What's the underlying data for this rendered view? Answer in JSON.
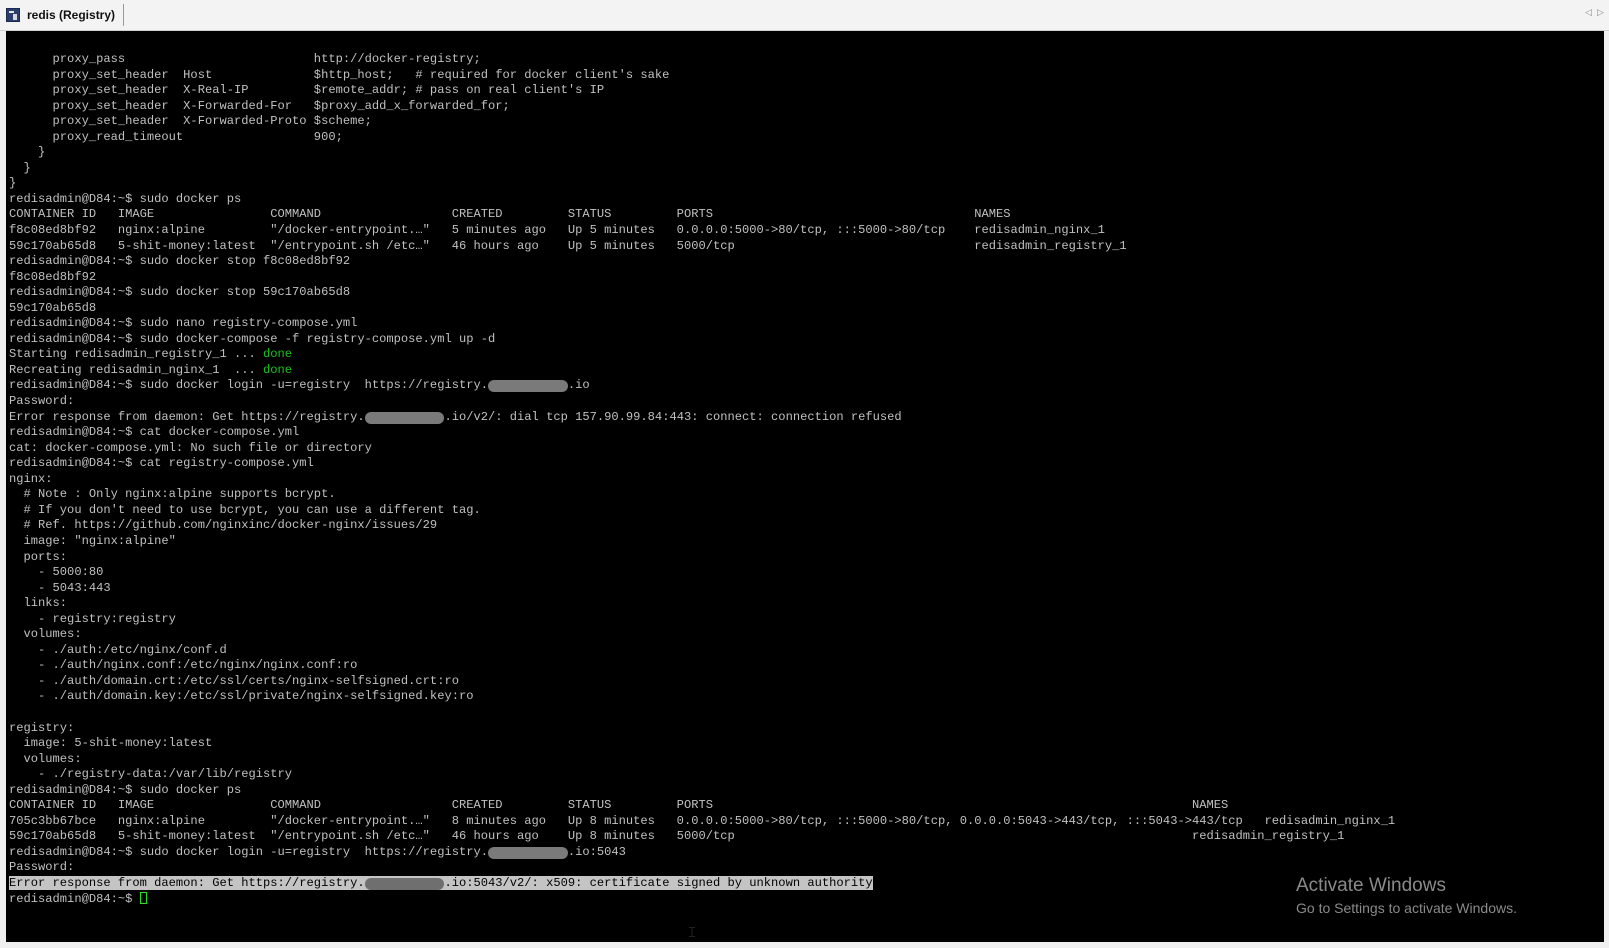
{
  "window": {
    "tab_title": "redis (Registry)",
    "scroll_left": "◁",
    "scroll_right": "▷"
  },
  "terminal": {
    "lines": [
      {
        "text": "      proxy_pass                          http://docker-registry;"
      },
      {
        "text": "      proxy_set_header  Host              $http_host;   # required for docker client's sake"
      },
      {
        "text": "      proxy_set_header  X-Real-IP         $remote_addr; # pass on real client's IP"
      },
      {
        "text": "      proxy_set_header  X-Forwarded-For   $proxy_add_x_forwarded_for;"
      },
      {
        "text": "      proxy_set_header  X-Forwarded-Proto $scheme;"
      },
      {
        "text": "      proxy_read_timeout                  900;"
      },
      {
        "text": "    }"
      },
      {
        "text": "  }"
      },
      {
        "text": "}"
      },
      {
        "text": "redisadmin@D84:~$ sudo docker ps"
      },
      {
        "text": "CONTAINER ID   IMAGE                COMMAND                  CREATED         STATUS         PORTS                                    NAMES"
      },
      {
        "text": "f8c08ed8bf92   nginx:alpine         \"/docker-entrypoint.…\"   5 minutes ago   Up 5 minutes   0.0.0.0:5000->80/tcp, :::5000->80/tcp    redisadmin_nginx_1"
      },
      {
        "text": "59c170ab65d8   5-shit-money:latest  \"/entrypoint.sh /etc…\"   46 hours ago    Up 5 minutes   5000/tcp                                 redisadmin_registry_1"
      },
      {
        "text": "redisadmin@D84:~$ sudo docker stop f8c08ed8bf92"
      },
      {
        "text": "f8c08ed8bf92"
      },
      {
        "text": "redisadmin@D84:~$ sudo docker stop 59c170ab65d8"
      },
      {
        "text": "59c170ab65d8"
      },
      {
        "text": "redisadmin@D84:~$ sudo nano registry-compose.yml"
      },
      {
        "text": "redisadmin@D84:~$ sudo docker-compose -f registry-compose.yml up -d"
      },
      {
        "text": "Starting redisadmin_registry_1 ... ",
        "status": "done"
      },
      {
        "text": "Recreating redisadmin_nginx_1  ... ",
        "status": "done"
      },
      {
        "text": "redisadmin@D84:~$ sudo docker login -u=registry  https://registry.",
        "redacted": "xxxxxxxxxxx",
        "after": ".io"
      },
      {
        "text": "Password:"
      },
      {
        "text": "Error response from daemon: Get https://registry.",
        "redacted": "xxxxxxxxxxx",
        "after": ".io/v2/: dial tcp 157.90.99.84:443: connect: connection refused"
      },
      {
        "text": "redisadmin@D84:~$ cat docker-compose.yml"
      },
      {
        "text": "cat: docker-compose.yml: No such file or directory"
      },
      {
        "text": "redisadmin@D84:~$ cat registry-compose.yml"
      },
      {
        "text": "nginx:"
      },
      {
        "text": "  # Note : Only nginx:alpine supports bcrypt."
      },
      {
        "text": "  # If you don't need to use bcrypt, you can use a different tag."
      },
      {
        "text": "  # Ref. https://github.com/nginxinc/docker-nginx/issues/29"
      },
      {
        "text": "  image: \"nginx:alpine\""
      },
      {
        "text": "  ports:"
      },
      {
        "text": "    - 5000:80"
      },
      {
        "text": "    - 5043:443"
      },
      {
        "text": "  links:"
      },
      {
        "text": "    - registry:registry"
      },
      {
        "text": "  volumes:"
      },
      {
        "text": "    - ./auth:/etc/nginx/conf.d"
      },
      {
        "text": "    - ./auth/nginx.conf:/etc/nginx/nginx.conf:ro"
      },
      {
        "text": "    - ./auth/domain.crt:/etc/ssl/certs/nginx-selfsigned.crt:ro"
      },
      {
        "text": "    - ./auth/domain.key:/etc/ssl/private/nginx-selfsigned.key:ro"
      },
      {
        "text": ""
      },
      {
        "text": "registry:"
      },
      {
        "text": "  image: 5-shit-money:latest"
      },
      {
        "text": "  volumes:"
      },
      {
        "text": "    - ./registry-data:/var/lib/registry"
      },
      {
        "text": "redisadmin@D84:~$ sudo docker ps"
      },
      {
        "text": "CONTAINER ID   IMAGE                COMMAND                  CREATED         STATUS         PORTS                                                                  NAMES"
      },
      {
        "text": "705c3bb67bce   nginx:alpine         \"/docker-entrypoint.…\"   8 minutes ago   Up 8 minutes   0.0.0.0:5000->80/tcp, :::5000->80/tcp, 0.0.0.0:5043->443/tcp, :::5043->443/tcp   redisadmin_nginx_1"
      },
      {
        "text": "59c170ab65d8   5-shit-money:latest  \"/entrypoint.sh /etc…\"   46 hours ago    Up 8 minutes   5000/tcp                                                               redisadmin_registry_1"
      },
      {
        "text": "redisadmin@D84:~$ sudo docker login -u=registry  https://registry.",
        "redacted": "xxxxxxxxxxx",
        "after": ".io:5043"
      },
      {
        "text": "Password:"
      },
      {
        "text": "Error response from daemon: Get https://registry.",
        "redacted": "xxxxxxxxxxx",
        "after": ".io:5043/v2/: x509: certificate signed by unknown authority",
        "selected": true
      },
      {
        "text": "redisadmin@D84:~$ ",
        "cursor": true
      }
    ]
  },
  "watermark": {
    "title": "Activate Windows",
    "subtitle": "Go to Settings to activate Windows."
  }
}
